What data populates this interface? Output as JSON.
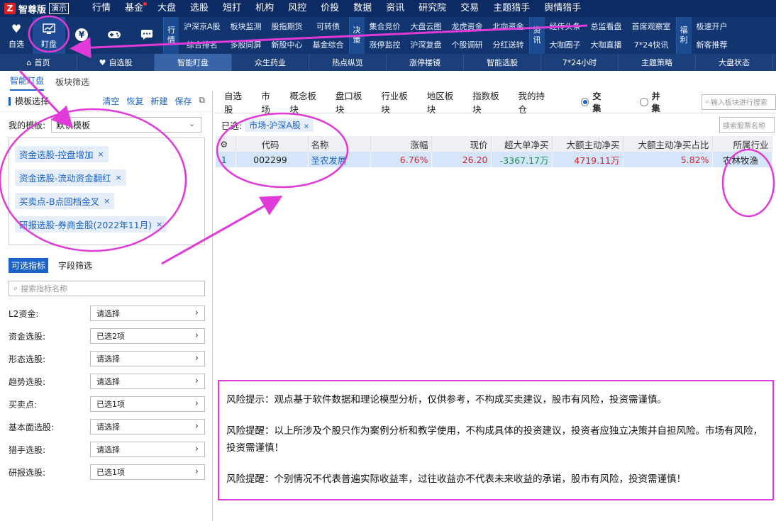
{
  "app": {
    "logo_mark": "Z",
    "name": "智尊版",
    "badge": "演示"
  },
  "menu": [
    "行情",
    "基金",
    "大盘",
    "选股",
    "短打",
    "机构",
    "风控",
    "价投",
    "数据",
    "资讯",
    "研究院",
    "交易",
    "主题猎手",
    "舆情猎手"
  ],
  "toolbar": {
    "buttons": [
      {
        "label": "自选",
        "icon": "heart-icon",
        "glyph": "♥"
      },
      {
        "label": "盯盘",
        "icon": "chart-monitor-icon",
        "glyph": "📈"
      },
      {
        "label": "",
        "icon": "yen-icon",
        "glyph": "¥"
      },
      {
        "label": "",
        "icon": "gamepad-icon",
        "glyph": "🎮"
      },
      {
        "label": "",
        "icon": "chat-icon",
        "glyph": "💬"
      }
    ],
    "groups": [
      {
        "label": [
          "行",
          "情"
        ],
        "items": [
          "沪深京A股",
          "综合排名",
          "板块监测",
          "多股同屏",
          "股指期货",
          "新股中心",
          "可转债",
          "基金综合"
        ]
      },
      {
        "label": [
          "决",
          "策"
        ],
        "items": [
          "集合竞价",
          "涨停监控",
          "大盘云图",
          "沪深复盘",
          "龙虎资金",
          "个股调研",
          "北向资金",
          "分红送转"
        ]
      },
      {
        "label": [
          "资",
          "讯"
        ],
        "items": [
          "经传头条",
          "大咖圈子",
          "总监看盘",
          "大咖直播",
          "首席观察室",
          "7*24快讯"
        ]
      },
      {
        "label": [
          "福",
          "利"
        ],
        "items": [
          "极速开户",
          "新客推荐"
        ]
      }
    ]
  },
  "nav": {
    "items": [
      "首页",
      "自选股",
      "智能盯盘",
      "众生药业",
      "热点纵览",
      "涨停楼镜",
      "智能选股",
      "7*24小时",
      "主题策略",
      "大盘状态"
    ],
    "active_index": 2
  },
  "subtabs": {
    "items": [
      "智能盯盘",
      "板块筛选"
    ],
    "active_index": 0
  },
  "left_panel": {
    "title": "模板选择",
    "actions": [
      "清空",
      "恢复",
      "新建",
      "保存"
    ],
    "template_label": "我的模板:",
    "template_value": "默认模板",
    "tags": [
      "资金选股-控盘增加",
      "资金选股-流动资金翻红",
      "买卖点-B点回档金叉",
      "研报选股-券商金股(2022年11月)"
    ],
    "tabs": [
      "可选指标",
      "字段筛选"
    ],
    "search_placeholder": "搜索指标名称",
    "filters": [
      {
        "label": "L2资金:",
        "value": "请选择"
      },
      {
        "label": "资金选股:",
        "value": "已选2项"
      },
      {
        "label": "形态选股:",
        "value": "请选择"
      },
      {
        "label": "趋势选股:",
        "value": "请选择"
      },
      {
        "label": "买卖点:",
        "value": "已选1项"
      },
      {
        "label": "基本面选股:",
        "value": "请选择"
      },
      {
        "label": "猎手选股:",
        "value": "请选择"
      },
      {
        "label": "研报选股:",
        "value": "已选1项"
      }
    ]
  },
  "right_panel": {
    "tabs": [
      "自选股",
      "市场",
      "概念板块",
      "盘口板块",
      "行业板块",
      "地区板块",
      "指数板块",
      "我的持仓"
    ],
    "radio": [
      {
        "label": "交集",
        "checked": true
      },
      {
        "label": "并集",
        "checked": false
      }
    ],
    "board_search_placeholder": "输入板块进行搜索",
    "selected_label": "已选:",
    "selected_chip": "市场-沪深A股",
    "stock_search_placeholder": "搜索股票名称",
    "table": {
      "headers": [
        "",
        "代码",
        "名称",
        "涨幅",
        "现价",
        "超大单净买",
        "大额主动净买",
        "大额主动净买占比",
        "所属行业"
      ],
      "rows": [
        {
          "idx": "1",
          "code": "002299",
          "name": "圣农发展",
          "change": "6.76%",
          "price": "26.20",
          "super_net": "-3367.17万",
          "big_net": "4719.11万",
          "big_ratio": "5.82%",
          "industry": "农林牧渔"
        }
      ]
    }
  },
  "notices": [
    "风险提示：观点基于软件数据和理论模型分析，仅供参考，不构成买卖建议，股市有风险，投资需谨慎。",
    "风险提醒：以上所涉及个股只作为案例分析和教学使用，不构成具体的投资建议，投资者应独立决策并自担风险。市场有风险，投资需谨慎！",
    "风险提醒：个别情况不代表普遍实际收益率，过往收益亦不代表未来收益的承诺，股市有风险，投资需谨慎！"
  ],
  "colors": {
    "up": "#e0202a",
    "down": "#15934a",
    "accent": "#1a63c8",
    "annotation": "#e03ad8"
  }
}
